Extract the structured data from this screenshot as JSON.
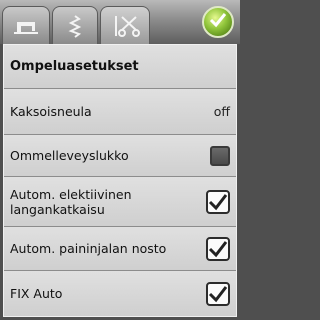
{
  "tabs": [
    {
      "name": "sewing-machine-tab",
      "icon": "sewing-machine-icon"
    },
    {
      "name": "stitch-tab",
      "icon": "zigzag-stitch-icon"
    },
    {
      "name": "settings-tab",
      "icon": "needle-scissors-icon",
      "active": true
    }
  ],
  "ok_button": {
    "icon": "checkmark-icon",
    "color": "#8fc43a"
  },
  "panel": {
    "title": "Ompeluasetukset",
    "rows": [
      {
        "label": "Kaksoisneula",
        "value": "off"
      },
      {
        "label": "Ommelleveyslukko",
        "checked": false
      },
      {
        "label": "Autom. elektiivinen langankatkaisu",
        "checked": true
      },
      {
        "label": "Autom. paininjalan nosto",
        "checked": true
      },
      {
        "label": "FIX Auto",
        "checked": true
      }
    ]
  }
}
